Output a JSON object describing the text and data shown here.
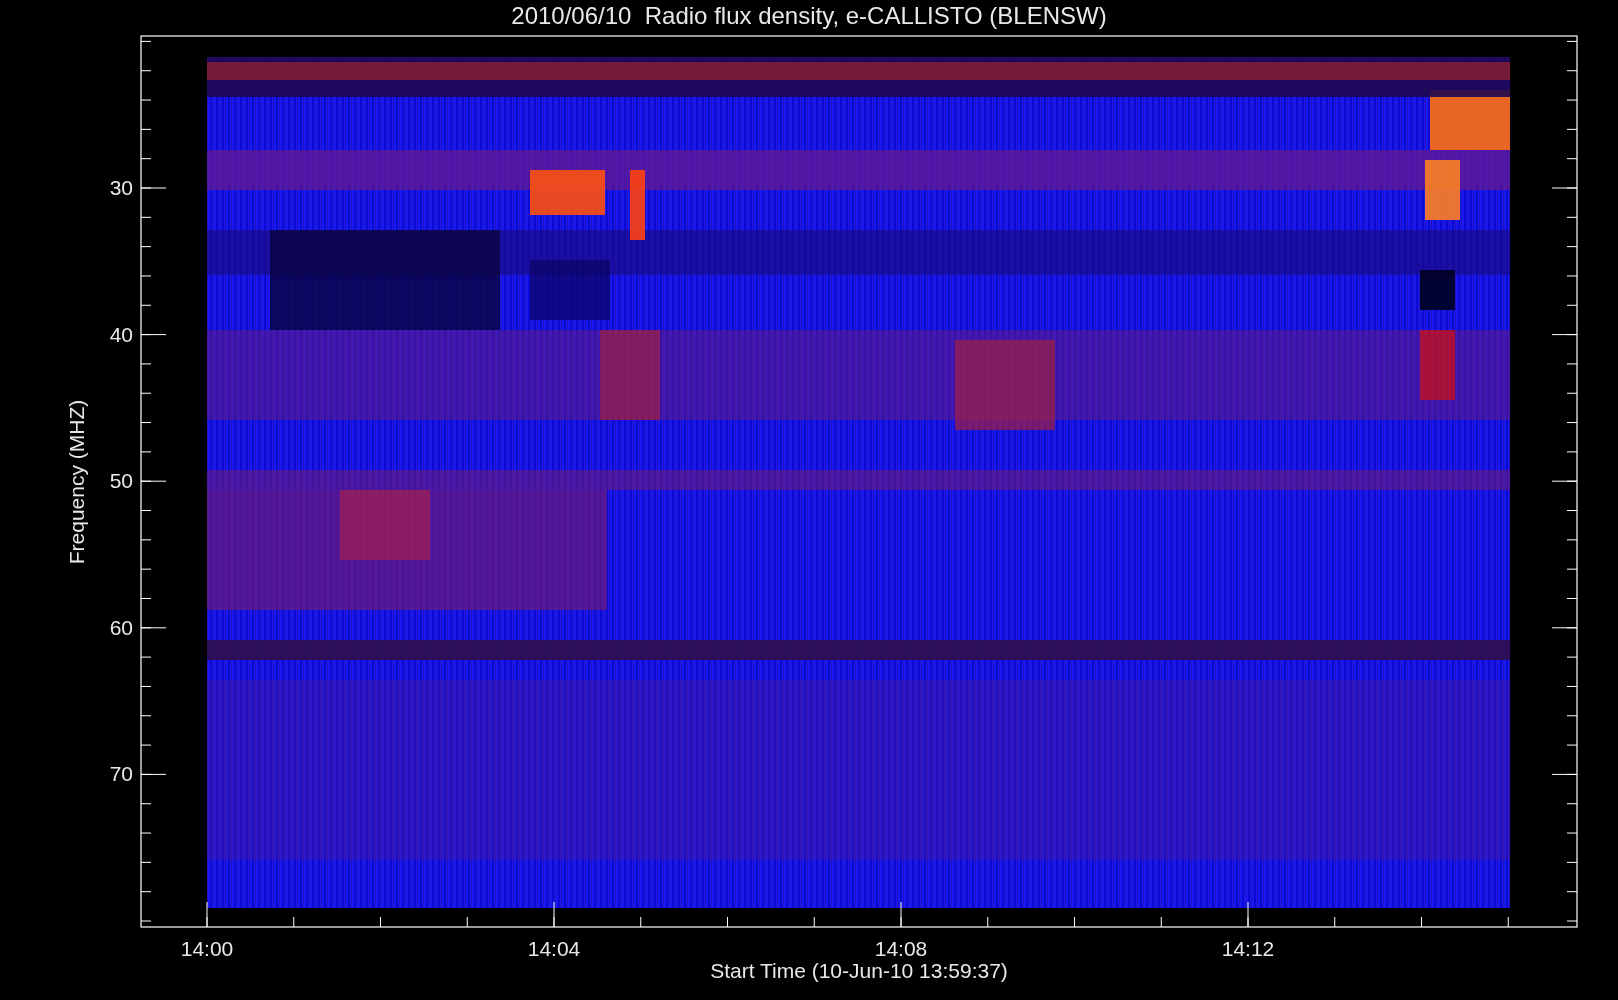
{
  "title": "2010/06/10  Radio flux density, e-CALLISTO (BLENSW)",
  "xlabel": "Start Time (10-Jun-10 13:59:37)",
  "ylabel": "Frequency (MHZ)",
  "xticks": [
    "14:00",
    "14:04",
    "14:08",
    "14:12"
  ],
  "yticks": [
    "30",
    "40",
    "50",
    "60",
    "70"
  ]
}
